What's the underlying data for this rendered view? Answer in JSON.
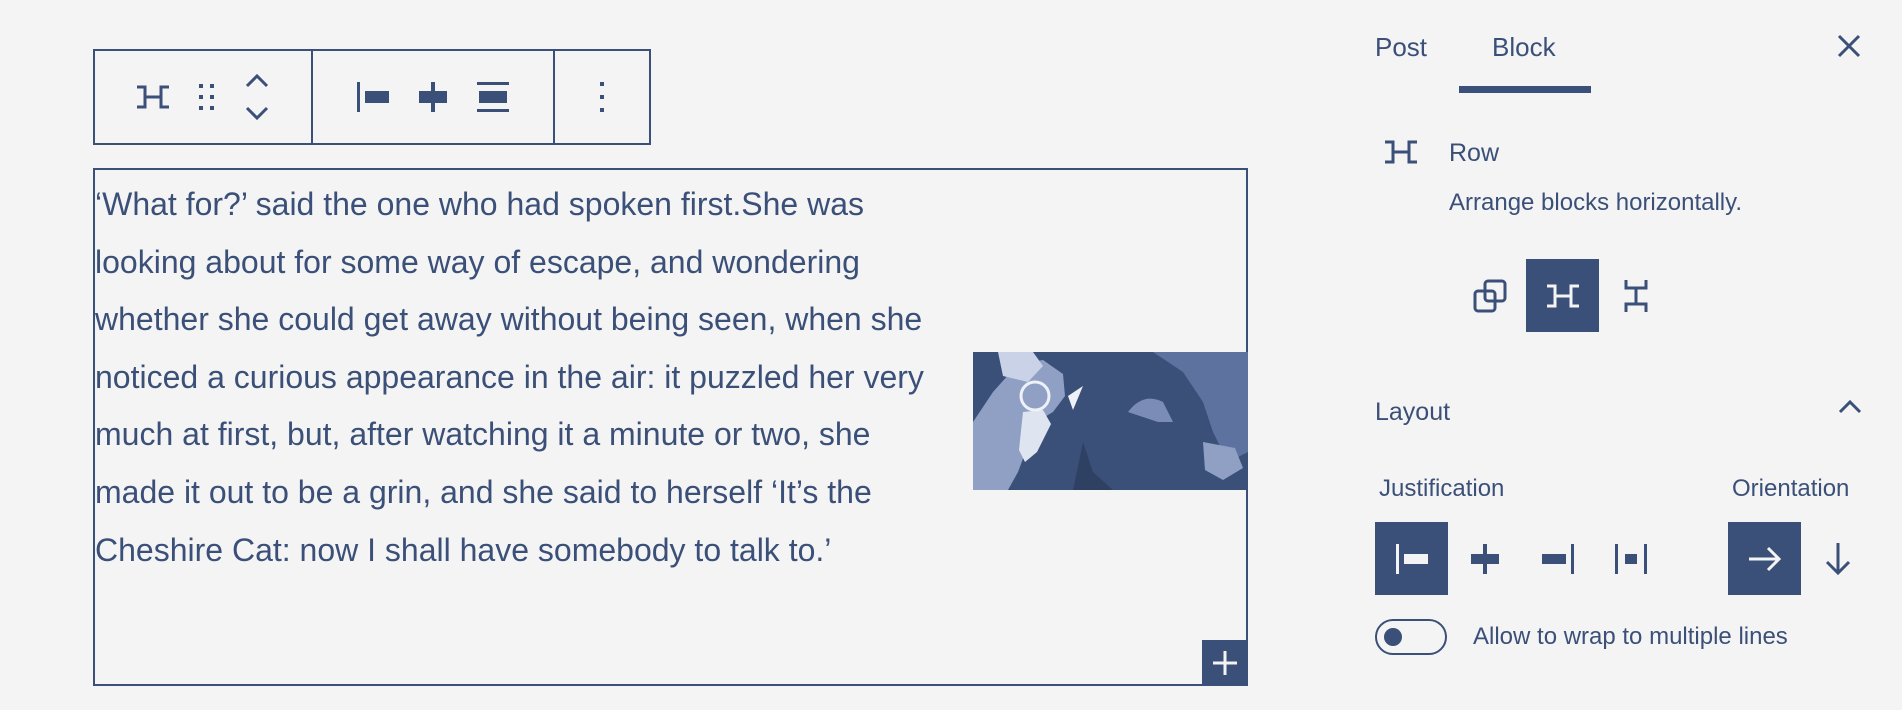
{
  "toolbar": {
    "groups": [
      {
        "items": [
          "row-icon",
          "drag-handle-icon",
          "move-up-down-icon"
        ]
      },
      {
        "items": [
          "justify-left-icon",
          "justify-center-icon",
          "justify-stretch-icon"
        ]
      },
      {
        "items": [
          "more-options-icon"
        ]
      }
    ]
  },
  "row_block": {
    "paragraph": "‘What for?’ said the one who had spoken first.She was looking about for some way of escape, and wondering whether she could get away without being seen, when she noticed a curious appearance in the air: it puzzled her very much at first, but, after watching it a minute or two, she made it out to be a grin, and she said to herself ‘It’s the Cheshire Cat: now I shall have somebody to talk to.’",
    "image_icon": "duotone-illustration"
  },
  "sidebar": {
    "tabs": [
      {
        "label": "Post",
        "active": false
      },
      {
        "label": "Block",
        "active": true
      }
    ],
    "block_card": {
      "title": "Row",
      "description": "Arrange blocks horizontally.",
      "icon": "row-icon"
    },
    "variations": [
      {
        "icon": "group-icon",
        "active": false
      },
      {
        "icon": "row-icon",
        "active": true
      },
      {
        "icon": "stack-icon",
        "active": false
      }
    ],
    "layout_panel": {
      "title": "Layout",
      "justification_label": "Justification",
      "orientation_label": "Orientation",
      "justification_options": [
        {
          "icon": "justify-left-icon",
          "active": true
        },
        {
          "icon": "justify-center-icon",
          "active": false
        },
        {
          "icon": "justify-right-icon",
          "active": false
        },
        {
          "icon": "justify-space-between-icon",
          "active": false
        }
      ],
      "orientation_options": [
        {
          "icon": "arrow-right-icon",
          "active": true
        },
        {
          "icon": "arrow-down-icon",
          "active": false
        }
      ],
      "wrap_label": "Allow to wrap to multiple lines",
      "wrap_enabled": false
    }
  },
  "colors": {
    "primary": "#3b5078",
    "background": "#f4f4f4"
  }
}
